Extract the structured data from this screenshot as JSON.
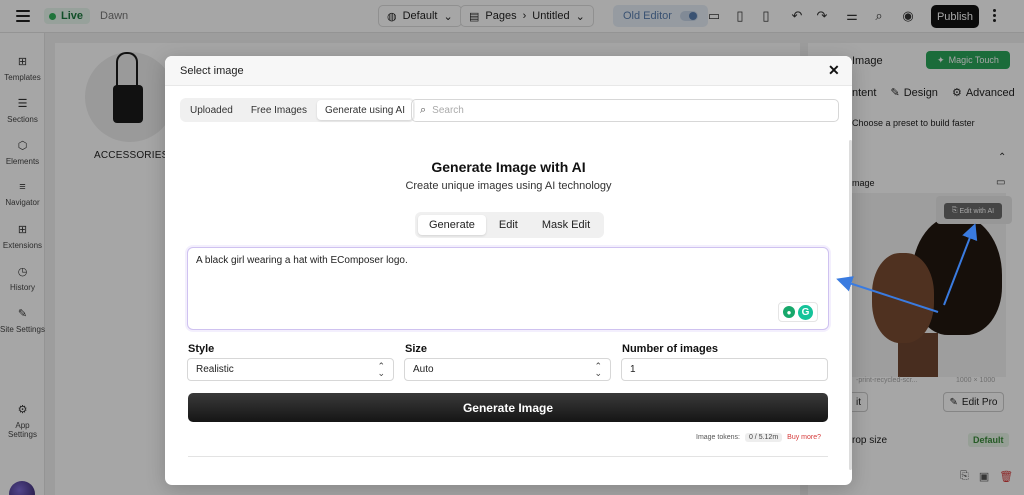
{
  "topbar": {
    "live_label": "Live",
    "theme_name": "Dawn",
    "device_label": "Default",
    "pages_label": "Pages",
    "page_name": "Untitled",
    "old_editor_label": "Old Editor",
    "publish_label": "Publish"
  },
  "sidebar": {
    "items": [
      {
        "label": "Templates",
        "icon": "templates-icon"
      },
      {
        "label": "Sections",
        "icon": "sections-icon"
      },
      {
        "label": "Elements",
        "icon": "elements-icon"
      },
      {
        "label": "Navigator",
        "icon": "navigator-icon"
      },
      {
        "label": "Extensions",
        "icon": "extensions-icon"
      },
      {
        "label": "History",
        "icon": "history-icon"
      },
      {
        "label": "Site Settings",
        "icon": "site-settings-icon"
      }
    ],
    "app_settings_label": "App Settings"
  },
  "canvas": {
    "category_label": "ACCESSORIES"
  },
  "right_panel": {
    "title_partial": "Image",
    "magic_touch_label": "Magic Touch",
    "tab_content_partial": "ntent",
    "tab_design": "Design",
    "tab_advanced": "Advanced",
    "preset_hint": "Choose a preset to build faster",
    "image_label_partial": "mage",
    "edit_with_ai": "Edit with AI",
    "filename_partial": "-print-recycled-scr...",
    "resolution": "1000 × 1000",
    "edit_partial": "it",
    "edit_pro": "Edit Pro",
    "crop_size_partial": "rop size",
    "crop_default": "Default"
  },
  "modal": {
    "title": "Select image",
    "tabs": [
      "Uploaded",
      "Free Images",
      "Generate using AI"
    ],
    "active_tab": "Generate using AI",
    "search_placeholder": "Search",
    "heading": "Generate Image with AI",
    "subheading": "Create unique images using AI technology",
    "modes": [
      "Generate",
      "Edit",
      "Mask Edit"
    ],
    "active_mode": "Generate",
    "prompt_value": "A black girl wearing a hat with EComposer logo.",
    "style": {
      "label": "Style",
      "value": "Realistic"
    },
    "size": {
      "label": "Size",
      "value": "Auto"
    },
    "count": {
      "label": "Number of images",
      "value": "1"
    },
    "generate_button": "Generate Image",
    "tokens_label": "Image tokens:",
    "tokens_value": "0 / 5.12m",
    "buy_more": "Buy more?"
  },
  "colors": {
    "live_green": "#2eb35a",
    "magic_green": "#2aa65a",
    "arrow_blue": "#3a7be0",
    "buy_red": "#d63a3a"
  }
}
